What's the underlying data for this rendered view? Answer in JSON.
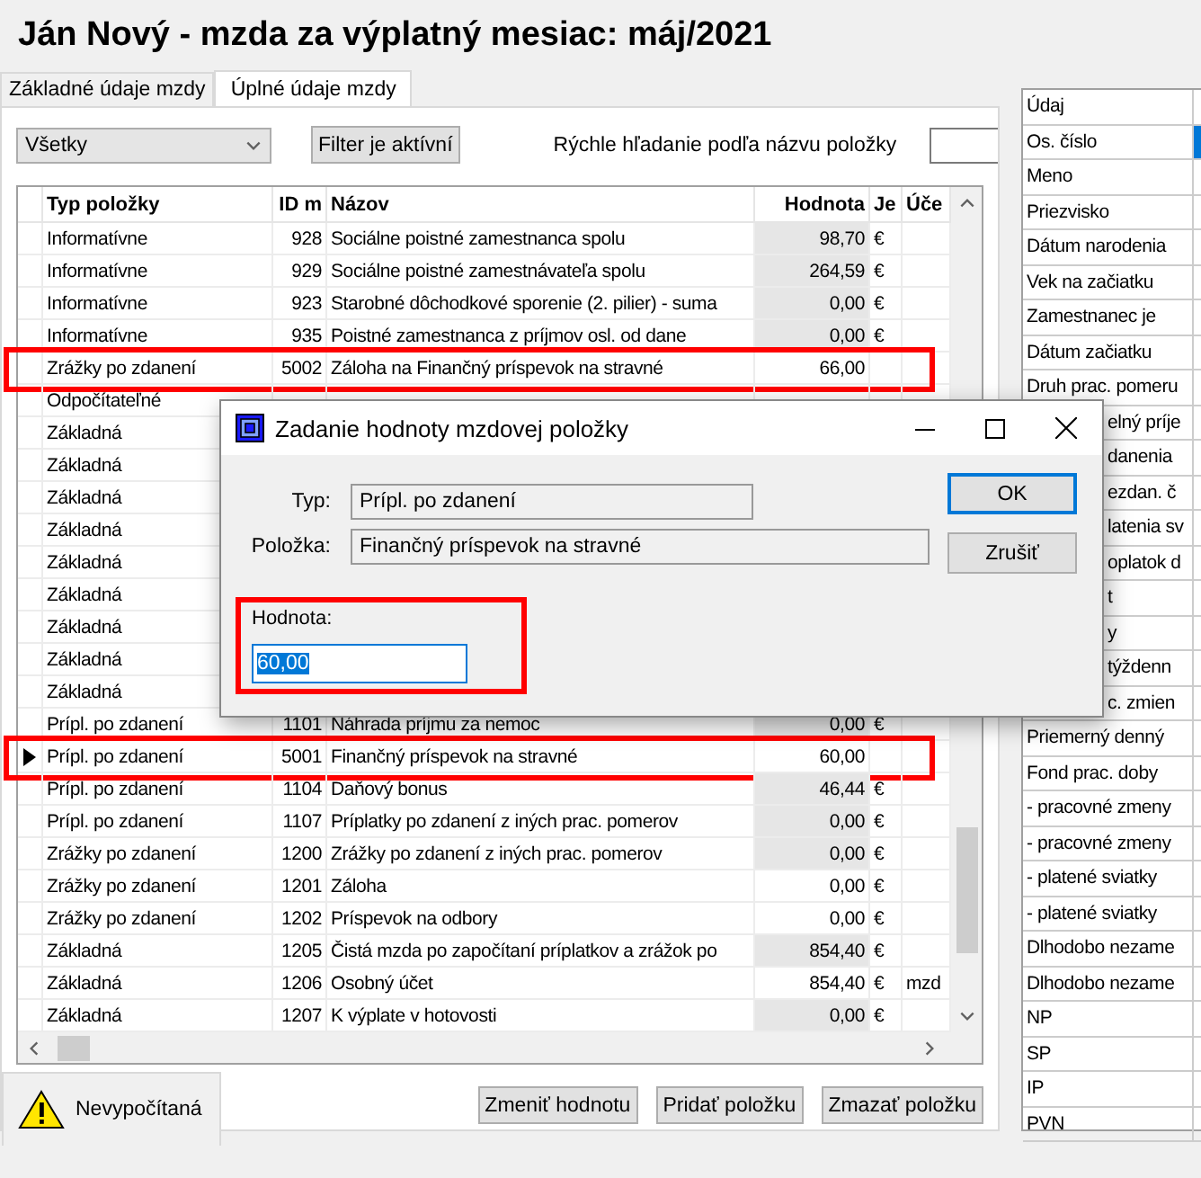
{
  "window": {
    "title": "Ján Nový - mzda za výplatný mesiac: máj/2021"
  },
  "tabs": [
    {
      "label": "Základné údaje mzdy",
      "selected": false
    },
    {
      "label": "Úplné údaje mzdy",
      "selected": true
    }
  ],
  "toolbar": {
    "filter": {
      "value": "Všetky"
    },
    "filter_button": "Filter je aktívní",
    "search": {
      "label": "Rýchle hľadanie podľa názvu položky"
    }
  },
  "table": {
    "columns": [
      "Typ položky",
      "ID m",
      "Názov",
      "Hodnota",
      "Je",
      "Úče"
    ],
    "rows": [
      {
        "type": "Informatívne",
        "id": "928",
        "name": "Sociálne poistné zamestnanca spolu",
        "value": "98,70",
        "unit": "€",
        "shaded": true,
        "selected": false,
        "highlighted": false
      },
      {
        "type": "Informatívne",
        "id": "929",
        "name": "Sociálne poistné zamestnávateľa spolu",
        "value": "264,59",
        "unit": "€",
        "shaded": true,
        "selected": false,
        "highlighted": false
      },
      {
        "type": "Informatívne",
        "id": "923",
        "name": "Starobné dôchodkové sporenie (2. pilier) - suma",
        "value": "0,00",
        "unit": "€",
        "shaded": true,
        "selected": false,
        "highlighted": false
      },
      {
        "type": "Informatívne",
        "id": "935",
        "name": "Poistné zamestnanca z príjmov osl. od dane",
        "value": "0,00",
        "unit": "€",
        "shaded": true,
        "selected": false,
        "highlighted": false
      },
      {
        "type": "Zrážky po zdanení",
        "id": "5002",
        "name": "Záloha na Finančný príspevok na stravné",
        "value": "66,00",
        "shaded": false,
        "selected": false,
        "highlighted": true
      },
      {
        "type": "Odpočítateľné",
        "selected": false,
        "highlighted": false
      },
      {
        "type": "Základná",
        "selected": false,
        "highlighted": false
      },
      {
        "type": "Základná",
        "selected": false,
        "highlighted": false
      },
      {
        "type": "Základná",
        "selected": false,
        "highlighted": false
      },
      {
        "type": "Základná",
        "selected": false,
        "highlighted": false
      },
      {
        "type": "Základná",
        "selected": false,
        "highlighted": false
      },
      {
        "type": "Základná",
        "selected": false,
        "highlighted": false
      },
      {
        "type": "Základná",
        "selected": false,
        "highlighted": false
      },
      {
        "type": "Základná",
        "selected": false,
        "highlighted": false
      },
      {
        "type": "Základná",
        "selected": false,
        "highlighted": false
      },
      {
        "type": "Prípl. po zdanení",
        "id": "1101",
        "name": "Náhrada príjmu za nemoc",
        "value": "0,00",
        "unit": "€",
        "shaded": true,
        "selected": false,
        "highlighted": false
      },
      {
        "type": "Prípl. po zdanení",
        "id": "5001",
        "name": "Finančný príspevok na stravné",
        "value": "60,00",
        "shaded": false,
        "selected": true,
        "highlighted": true
      },
      {
        "type": "Prípl. po zdanení",
        "id": "1104",
        "name": "Daňový bonus",
        "value": "46,44",
        "unit": "€",
        "shaded": true,
        "selected": false,
        "highlighted": false
      },
      {
        "type": "Prípl. po zdanení",
        "id": "1107",
        "name": "Príplatky po zdanení z iných prac. pomerov",
        "value": "0,00",
        "unit": "€",
        "shaded": true,
        "selected": false,
        "highlighted": false
      },
      {
        "type": "Zrážky po zdanení",
        "id": "1200",
        "name": "Zrážky po zdanení z iných prac. pomerov",
        "value": "0,00",
        "unit": "€",
        "shaded": true,
        "selected": false,
        "highlighted": false
      },
      {
        "type": "Zrážky po zdanení",
        "id": "1201",
        "name": "Záloha",
        "value": "0,00",
        "unit": "€",
        "shaded": false,
        "selected": false,
        "highlighted": false
      },
      {
        "type": "Zrážky po zdanení",
        "id": "1202",
        "name": "Príspevok na odbory",
        "value": "0,00",
        "unit": "€",
        "shaded": false,
        "selected": false,
        "highlighted": false
      },
      {
        "type": "Základná",
        "id": "1205",
        "name": "Čistá mzda po započítaní príplatkov a zrážok po",
        "value": "854,40",
        "unit": "€",
        "shaded": true,
        "selected": false,
        "highlighted": false
      },
      {
        "type": "Základná",
        "id": "1206",
        "name": "Osobný účet",
        "value": "854,40",
        "unit": "€",
        "account": "mzd",
        "shaded": false,
        "selected": false,
        "highlighted": false
      },
      {
        "type": "Základná",
        "id": "1207",
        "name": "K výplate v hotovosti",
        "value": "0,00",
        "unit": "€",
        "shaded": true,
        "selected": false,
        "highlighted": false
      }
    ]
  },
  "dialog": {
    "title": "Zadanie hodnoty mzdovej položky",
    "fields": [
      {
        "label": "Typ:",
        "value": "Prípl. po zdanení"
      },
      {
        "label": "Položka:",
        "value": "Finančný príspevok na stravné"
      }
    ],
    "amount": {
      "label": "Hodnota:",
      "value": "60,00",
      "highlighted": true
    },
    "buttons": [
      {
        "label": "OK",
        "focused": true
      },
      {
        "label": "Zrušiť",
        "focused": false
      }
    ]
  },
  "status": {
    "label": "Nevypočítaná"
  },
  "buttons": [
    "Zmeniť hodnotu",
    "Pridať položku",
    "Zmazať položku"
  ],
  "properties": {
    "columns": [
      "Údaj"
    ],
    "rows": [
      {
        "label": "Os. číslo",
        "selected": true,
        "covered": false
      },
      {
        "label": "Meno",
        "selected": false,
        "covered": false
      },
      {
        "label": "Priezvisko",
        "selected": false,
        "covered": false
      },
      {
        "label": "Dátum narodenia",
        "selected": false,
        "covered": false
      },
      {
        "label": "Vek na začiatku",
        "selected": false,
        "covered": false
      },
      {
        "label": "Zamestnanec je",
        "selected": false,
        "covered": false
      },
      {
        "label": "Dátum začiatku",
        "selected": false,
        "covered": false
      },
      {
        "label": "Druh prac. pomeru",
        "selected": false,
        "covered": false
      },
      {
        "label": "elný príje",
        "selected": false,
        "covered": true
      },
      {
        "label": "danenia",
        "selected": false,
        "covered": true
      },
      {
        "label": "ezdan. č",
        "selected": false,
        "covered": true
      },
      {
        "label": "latenia sv",
        "selected": false,
        "covered": true
      },
      {
        "label": "oplatok d",
        "selected": false,
        "covered": true
      },
      {
        "label": "t",
        "selected": false,
        "covered": true
      },
      {
        "label": "y",
        "selected": false,
        "covered": true
      },
      {
        "label": "týždenn",
        "selected": false,
        "covered": true
      },
      {
        "label": "c. zmien",
        "selected": false,
        "covered": true
      },
      {
        "label": "Priemerný denný",
        "selected": false,
        "covered": false
      },
      {
        "label": "Fond prac. doby",
        "selected": false,
        "covered": false
      },
      {
        "label": "- pracovné zmeny",
        "selected": false,
        "covered": false
      },
      {
        "label": "- pracovné zmeny",
        "selected": false,
        "covered": false
      },
      {
        "label": "- platené sviatky",
        "selected": false,
        "covered": false
      },
      {
        "label": "- platené sviatky",
        "selected": false,
        "covered": false
      },
      {
        "label": "Dlhodobo nezame",
        "selected": false,
        "covered": false
      },
      {
        "label": "Dlhodobo nezame",
        "selected": false,
        "covered": false
      },
      {
        "label": "NP",
        "selected": false,
        "covered": false
      },
      {
        "label": "SP",
        "selected": false,
        "covered": false
      },
      {
        "label": "IP",
        "selected": false,
        "covered": false
      },
      {
        "label": "PVN",
        "selected": false,
        "covered": false
      }
    ]
  }
}
